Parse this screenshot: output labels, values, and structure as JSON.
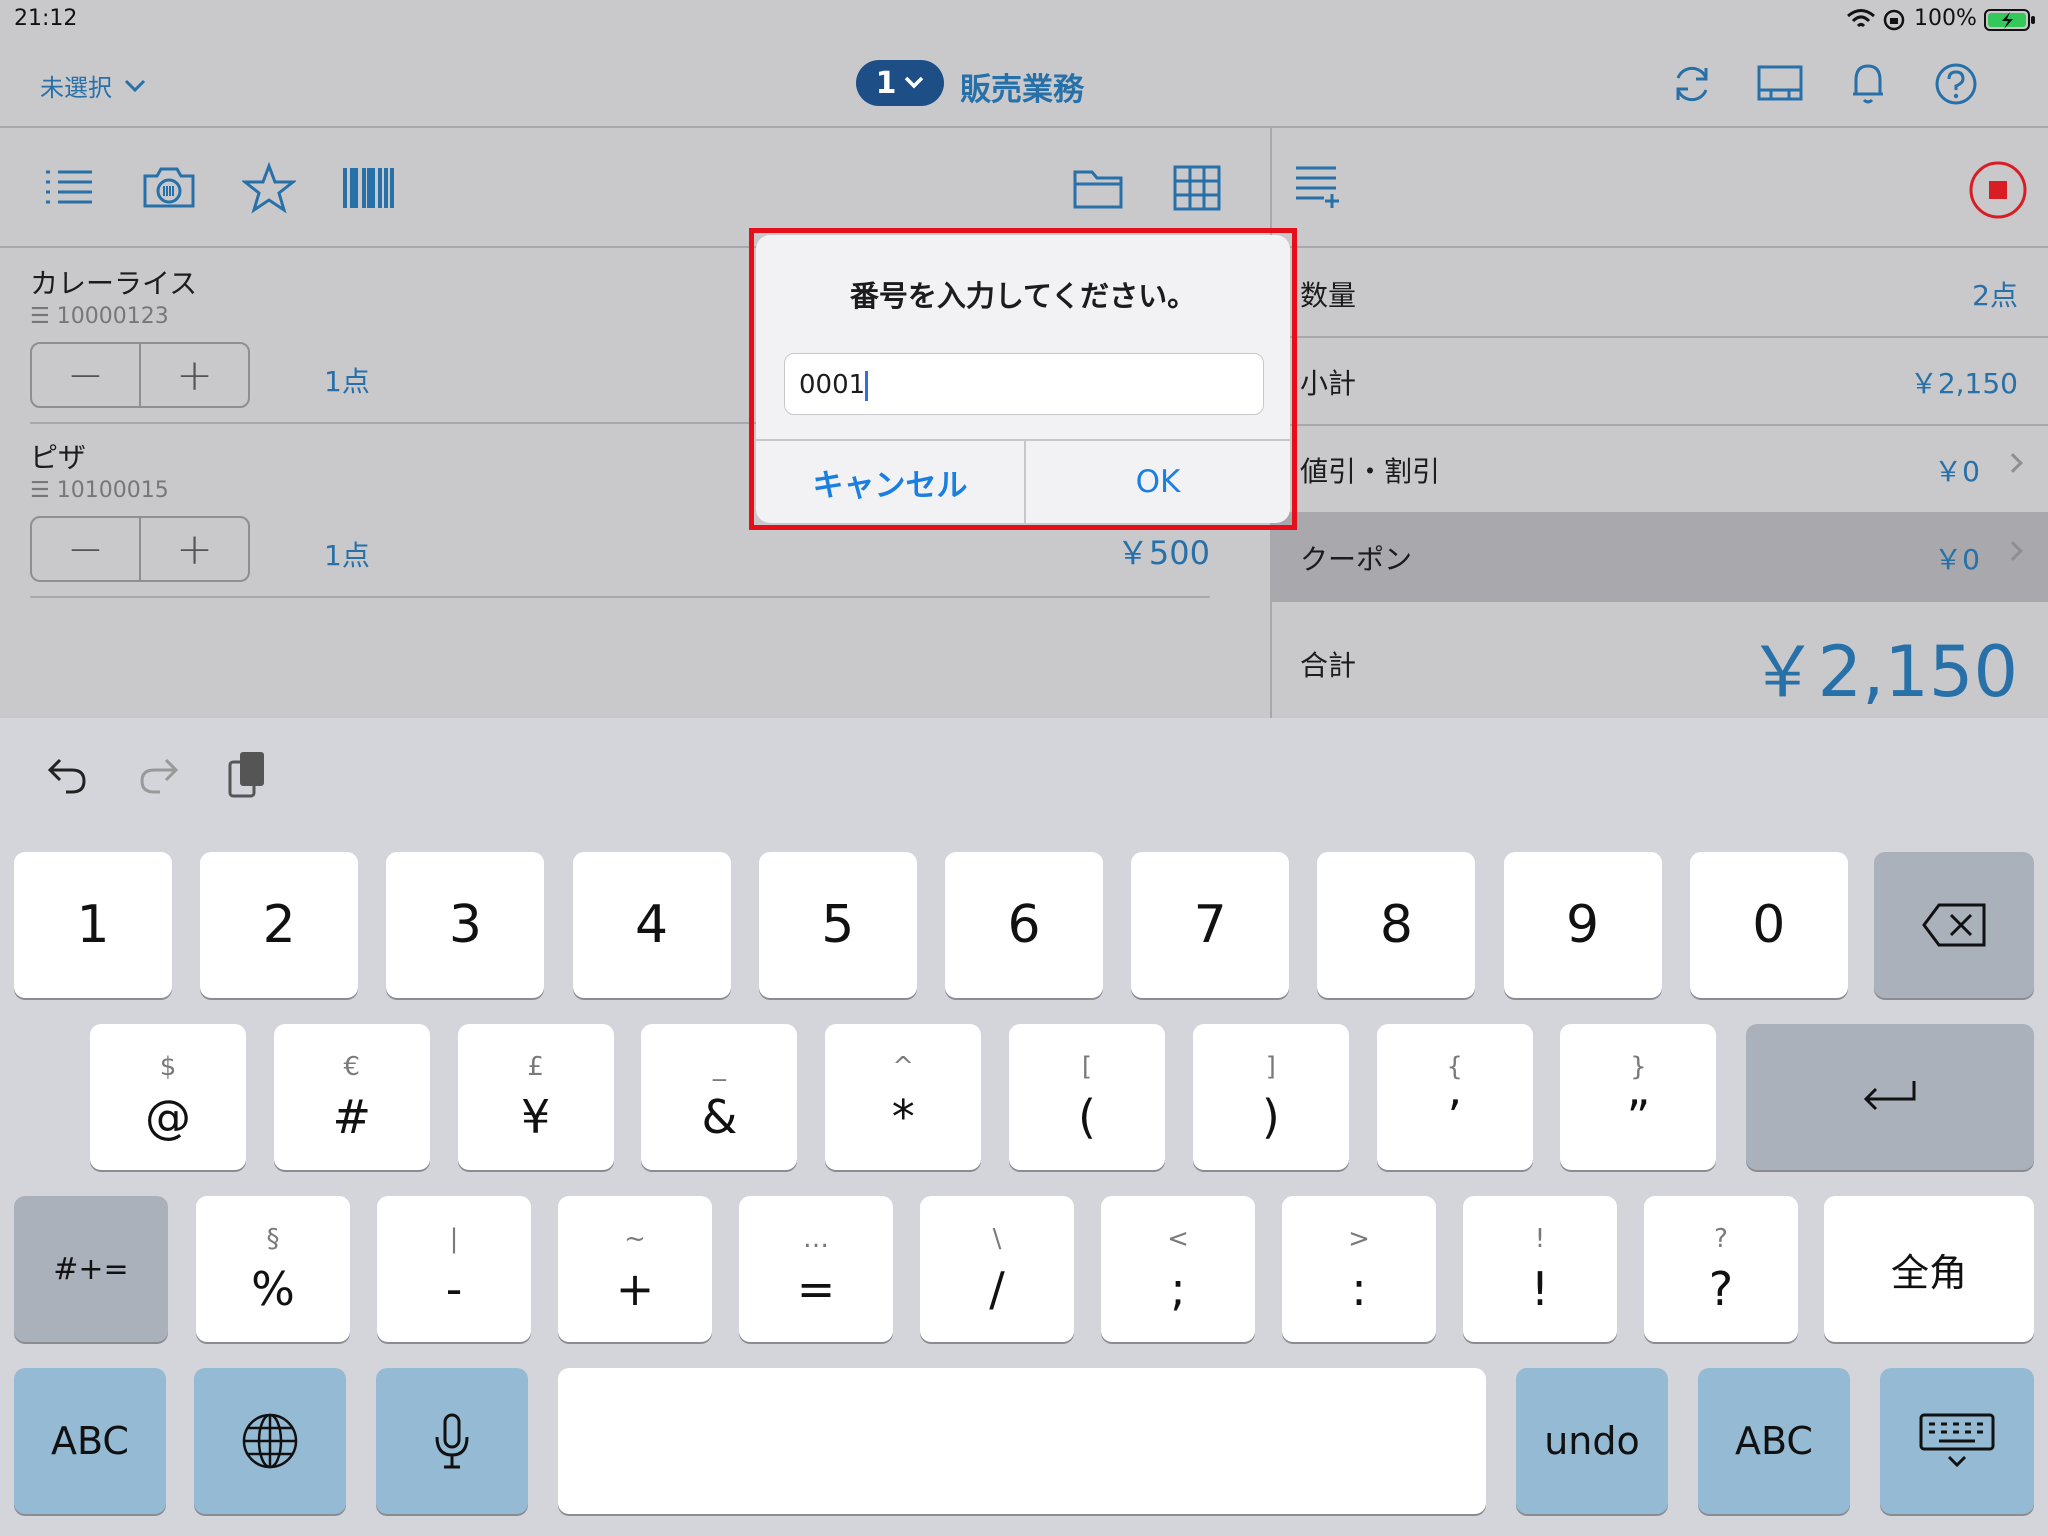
{
  "status_bar": {
    "time": "21:12",
    "battery": "100%"
  },
  "nav": {
    "customer_label": "未選択",
    "register_number": "1",
    "title": "販売業務"
  },
  "items": [
    {
      "name": "カレーライス",
      "code": "10000123",
      "qty": "1点",
      "price": ""
    },
    {
      "name": "ピザ",
      "code": "10100015",
      "qty": "1点",
      "price": "￥500"
    }
  ],
  "summary": {
    "quantity_label": "数量",
    "quantity_value": "2点",
    "subtotal_label": "小計",
    "subtotal_value": "￥2,150",
    "discount_label": "値引・割引",
    "discount_value": "￥0",
    "coupon_label": "クーポン",
    "coupon_value": "￥0",
    "total_label": "合計",
    "total_value": "￥2,150"
  },
  "dialog": {
    "title": "番号を入力してください。",
    "input_value": "0001",
    "cancel_label": "キャンセル",
    "ok_label": "OK"
  },
  "keyboard": {
    "row1": [
      "1",
      "2",
      "3",
      "4",
      "5",
      "6",
      "7",
      "8",
      "9",
      "0"
    ],
    "row2": [
      {
        "top": "$",
        "main": "@"
      },
      {
        "top": "€",
        "main": "#"
      },
      {
        "top": "£",
        "main": "¥"
      },
      {
        "top": "_",
        "main": "&"
      },
      {
        "top": "^",
        "main": "*"
      },
      {
        "top": "[",
        "main": "("
      },
      {
        "top": "]",
        "main": ")"
      },
      {
        "top": "{",
        "main": "’"
      },
      {
        "top": "}",
        "main": "”"
      }
    ],
    "row3": [
      {
        "top": "§",
        "main": "%"
      },
      {
        "top": "|",
        "main": "-"
      },
      {
        "top": "~",
        "main": "+"
      },
      {
        "top": "…",
        "main": "="
      },
      {
        "top": "\\",
        "main": "/"
      },
      {
        "top": "<",
        "main": ";"
      },
      {
        "top": ">",
        "main": ":"
      },
      {
        "top": "!",
        "main": "!"
      },
      {
        "top": "?",
        "main": "?"
      }
    ],
    "symbols_label": "#+=",
    "zenkaku_label": "全角",
    "abc_label": "ABC",
    "undo_label": "undo",
    "abc2_label": "ABC"
  },
  "colors": {
    "accent": "#2770a8",
    "highlight_frame": "#e3101b",
    "stop_button": "#d81e24"
  }
}
